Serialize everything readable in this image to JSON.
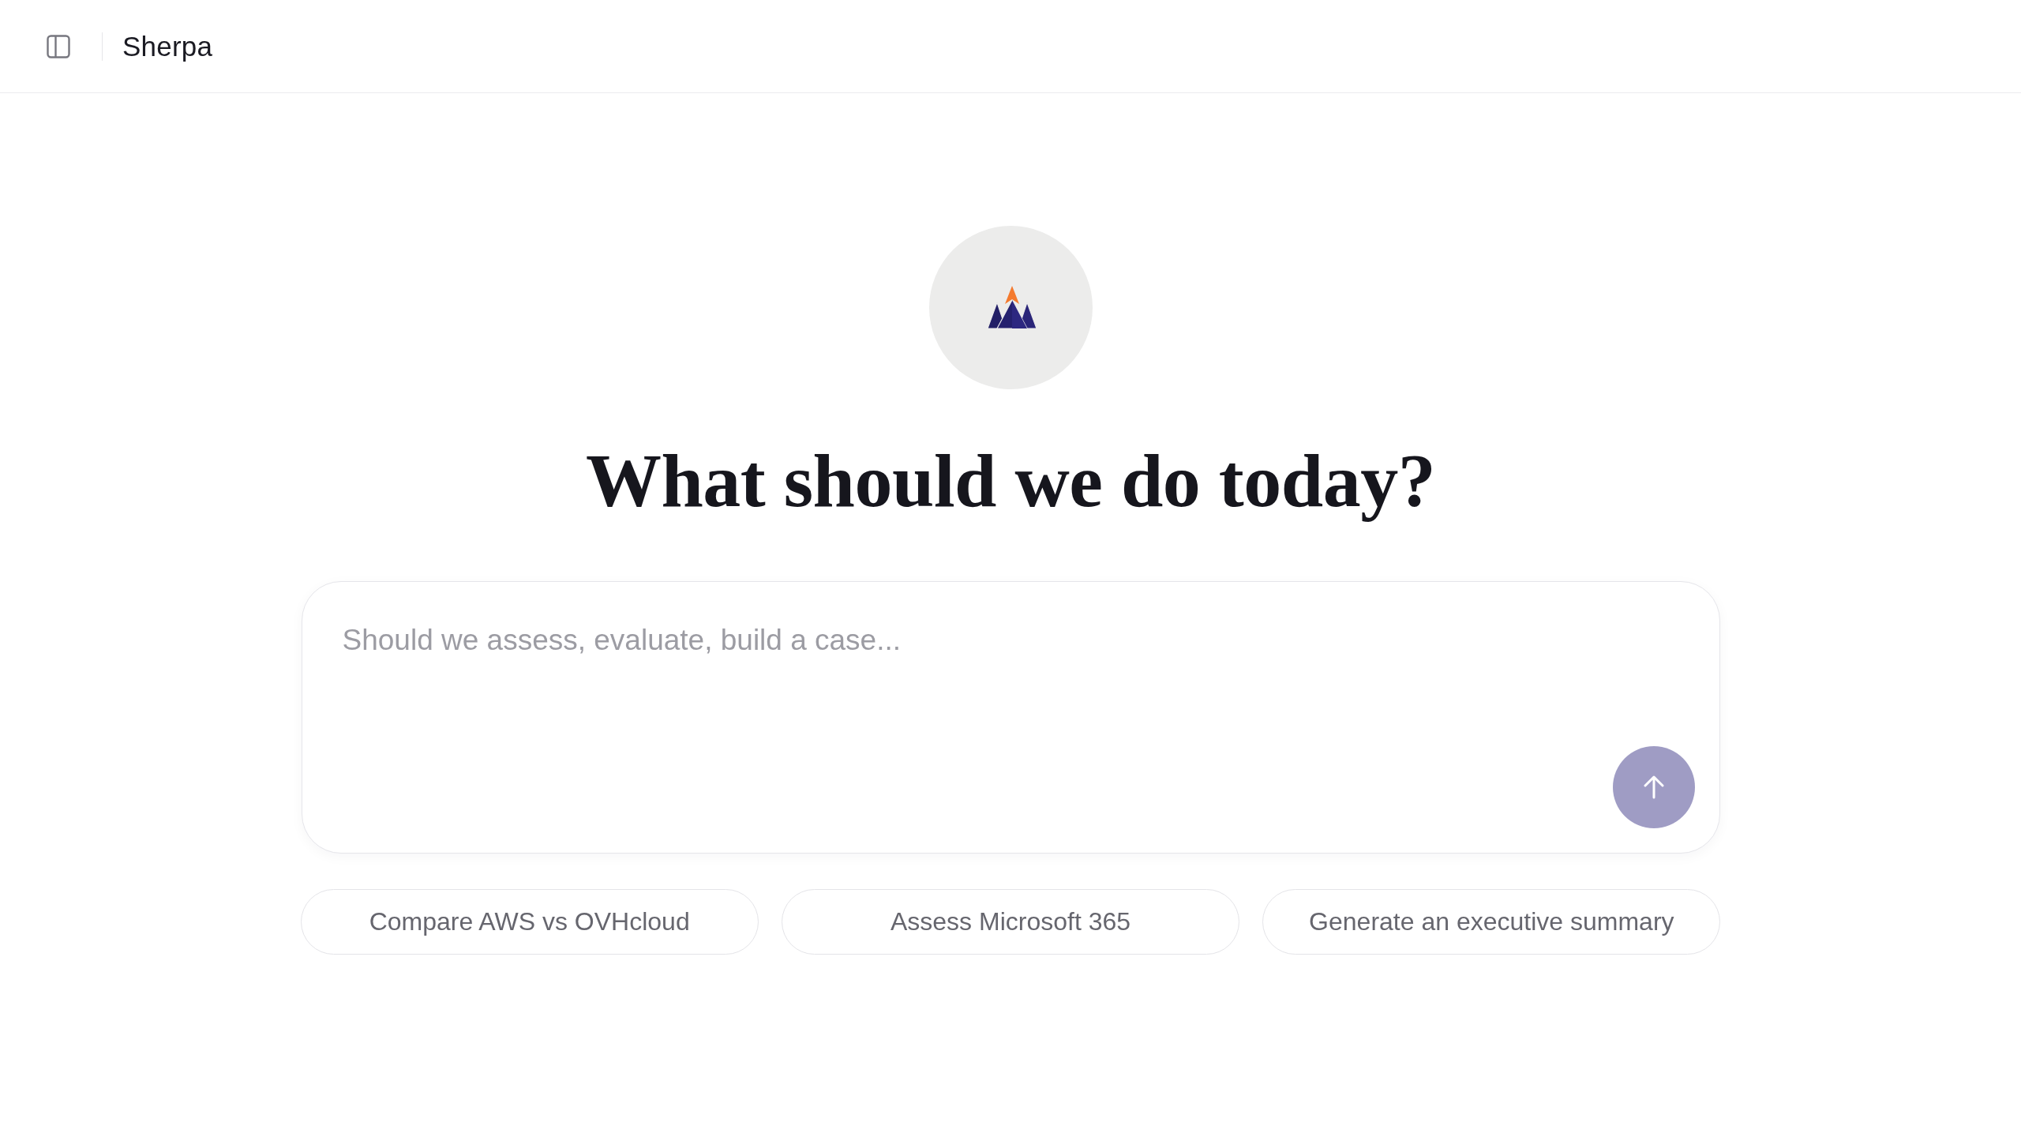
{
  "header": {
    "title": "Sherpa"
  },
  "hero": {
    "heading": "What should we do today?"
  },
  "composer": {
    "placeholder": "Should we assess, evaluate, build a case...",
    "send_button": {
      "disabled": true
    }
  },
  "suggestions": [
    {
      "label": "Compare AWS vs OVHcloud"
    },
    {
      "label": "Assess Microsoft 365"
    },
    {
      "label": "Generate an executive summary"
    }
  ]
}
